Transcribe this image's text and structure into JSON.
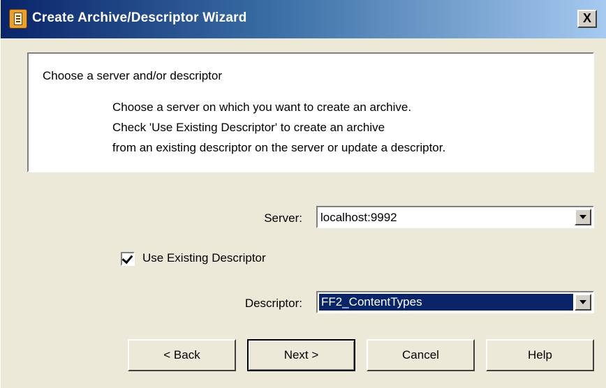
{
  "window": {
    "title": "Create Archive/Descriptor Wizard",
    "close_label": "X"
  },
  "info": {
    "heading": "Choose a server and/or descriptor",
    "lines": [
      "Choose a server on which you want to create an archive.",
      "Check 'Use Existing Descriptor' to create an archive",
      "from an existing descriptor on the server or update a descriptor."
    ]
  },
  "form": {
    "server_label": "Server:",
    "server_value": "localhost:9992",
    "use_existing_label": "Use Existing Descriptor",
    "use_existing_checked": true,
    "descriptor_label": "Descriptor:",
    "descriptor_value": "FF2_ContentTypes"
  },
  "buttons": {
    "back": "< Back",
    "next": "Next >",
    "cancel": "Cancel",
    "help": "Help"
  },
  "icons": {
    "title_icon": "wizard-app-icon",
    "dropdown": "chevron-down-icon",
    "check": "check-icon"
  },
  "colors": {
    "titlebar_start": "#0a246a",
    "titlebar_end": "#a6caf0",
    "selection": "#0a246a",
    "dialog_bg": "#ece9d8"
  }
}
